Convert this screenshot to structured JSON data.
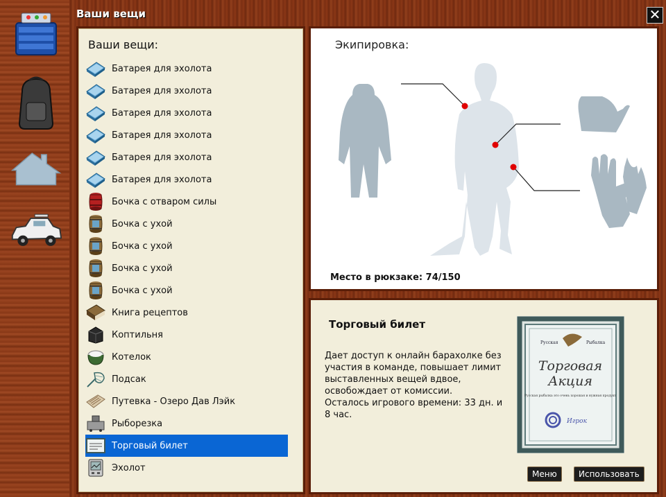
{
  "window": {
    "title": "Ваши вещи",
    "close_label": "✕"
  },
  "sidebar": {
    "buttons": [
      {
        "name": "tackle-box"
      },
      {
        "name": "backpack"
      },
      {
        "name": "house"
      },
      {
        "name": "car"
      }
    ]
  },
  "inventory": {
    "title": "Ваши вещи:",
    "items": [
      {
        "label": "Батарея для эхолота",
        "icon": "battery-icon"
      },
      {
        "label": "Батарея для эхолота",
        "icon": "battery-icon"
      },
      {
        "label": "Батарея для эхолота",
        "icon": "battery-icon"
      },
      {
        "label": "Батарея для эхолота",
        "icon": "battery-icon"
      },
      {
        "label": "Батарея для эхолота",
        "icon": "battery-icon"
      },
      {
        "label": "Батарея для эхолота",
        "icon": "battery-icon"
      },
      {
        "label": "Бочка с отваром силы",
        "icon": "red-barrel-icon"
      },
      {
        "label": "Бочка с ухой",
        "icon": "barrel-icon"
      },
      {
        "label": "Бочка с ухой",
        "icon": "barrel-icon"
      },
      {
        "label": "Бочка с ухой",
        "icon": "barrel-icon"
      },
      {
        "label": "Бочка с ухой",
        "icon": "barrel-icon"
      },
      {
        "label": "Книга рецептов",
        "icon": "book-icon"
      },
      {
        "label": "Коптильня",
        "icon": "smokehouse-icon"
      },
      {
        "label": "Котелок",
        "icon": "pot-icon"
      },
      {
        "label": "Подсак",
        "icon": "landing-net-icon"
      },
      {
        "label": "Путевка - Озеро Дав Лэйк",
        "icon": "voucher-icon"
      },
      {
        "label": "Рыборезка",
        "icon": "fish-cutter-icon"
      },
      {
        "label": "Торговый билет",
        "icon": "ticket-icon",
        "selected": true
      },
      {
        "label": "Эхолот",
        "icon": "echo-sounder-icon"
      }
    ]
  },
  "equipment": {
    "title": "Экипировка:",
    "capacity_label": "Место в рюкзаке: 74/150"
  },
  "details": {
    "title": "Торговый билет",
    "description": "Дает доступ к онлайн барахолке без участия в команде, повышает лимит выставленных вещей вдвое, освобождает от комиссии.",
    "time_left": "Осталось игрового времени: 33 дн. и 8 час.",
    "menu_button": "Меню",
    "use_button": "Использовать",
    "ticket_image": {
      "top_left": "Русская",
      "top_right": "Рыбалка",
      "title_line1": "Торговая",
      "title_line2": "Акция",
      "subtitle": "Русская рыбалка это очень хорошая и нужная продукт",
      "brand": "Игрок"
    }
  },
  "colors": {
    "selection": "#0a66d4",
    "panel": "#f2eedb",
    "marker": "#e00000",
    "silhouette": "#a9b8c2"
  }
}
